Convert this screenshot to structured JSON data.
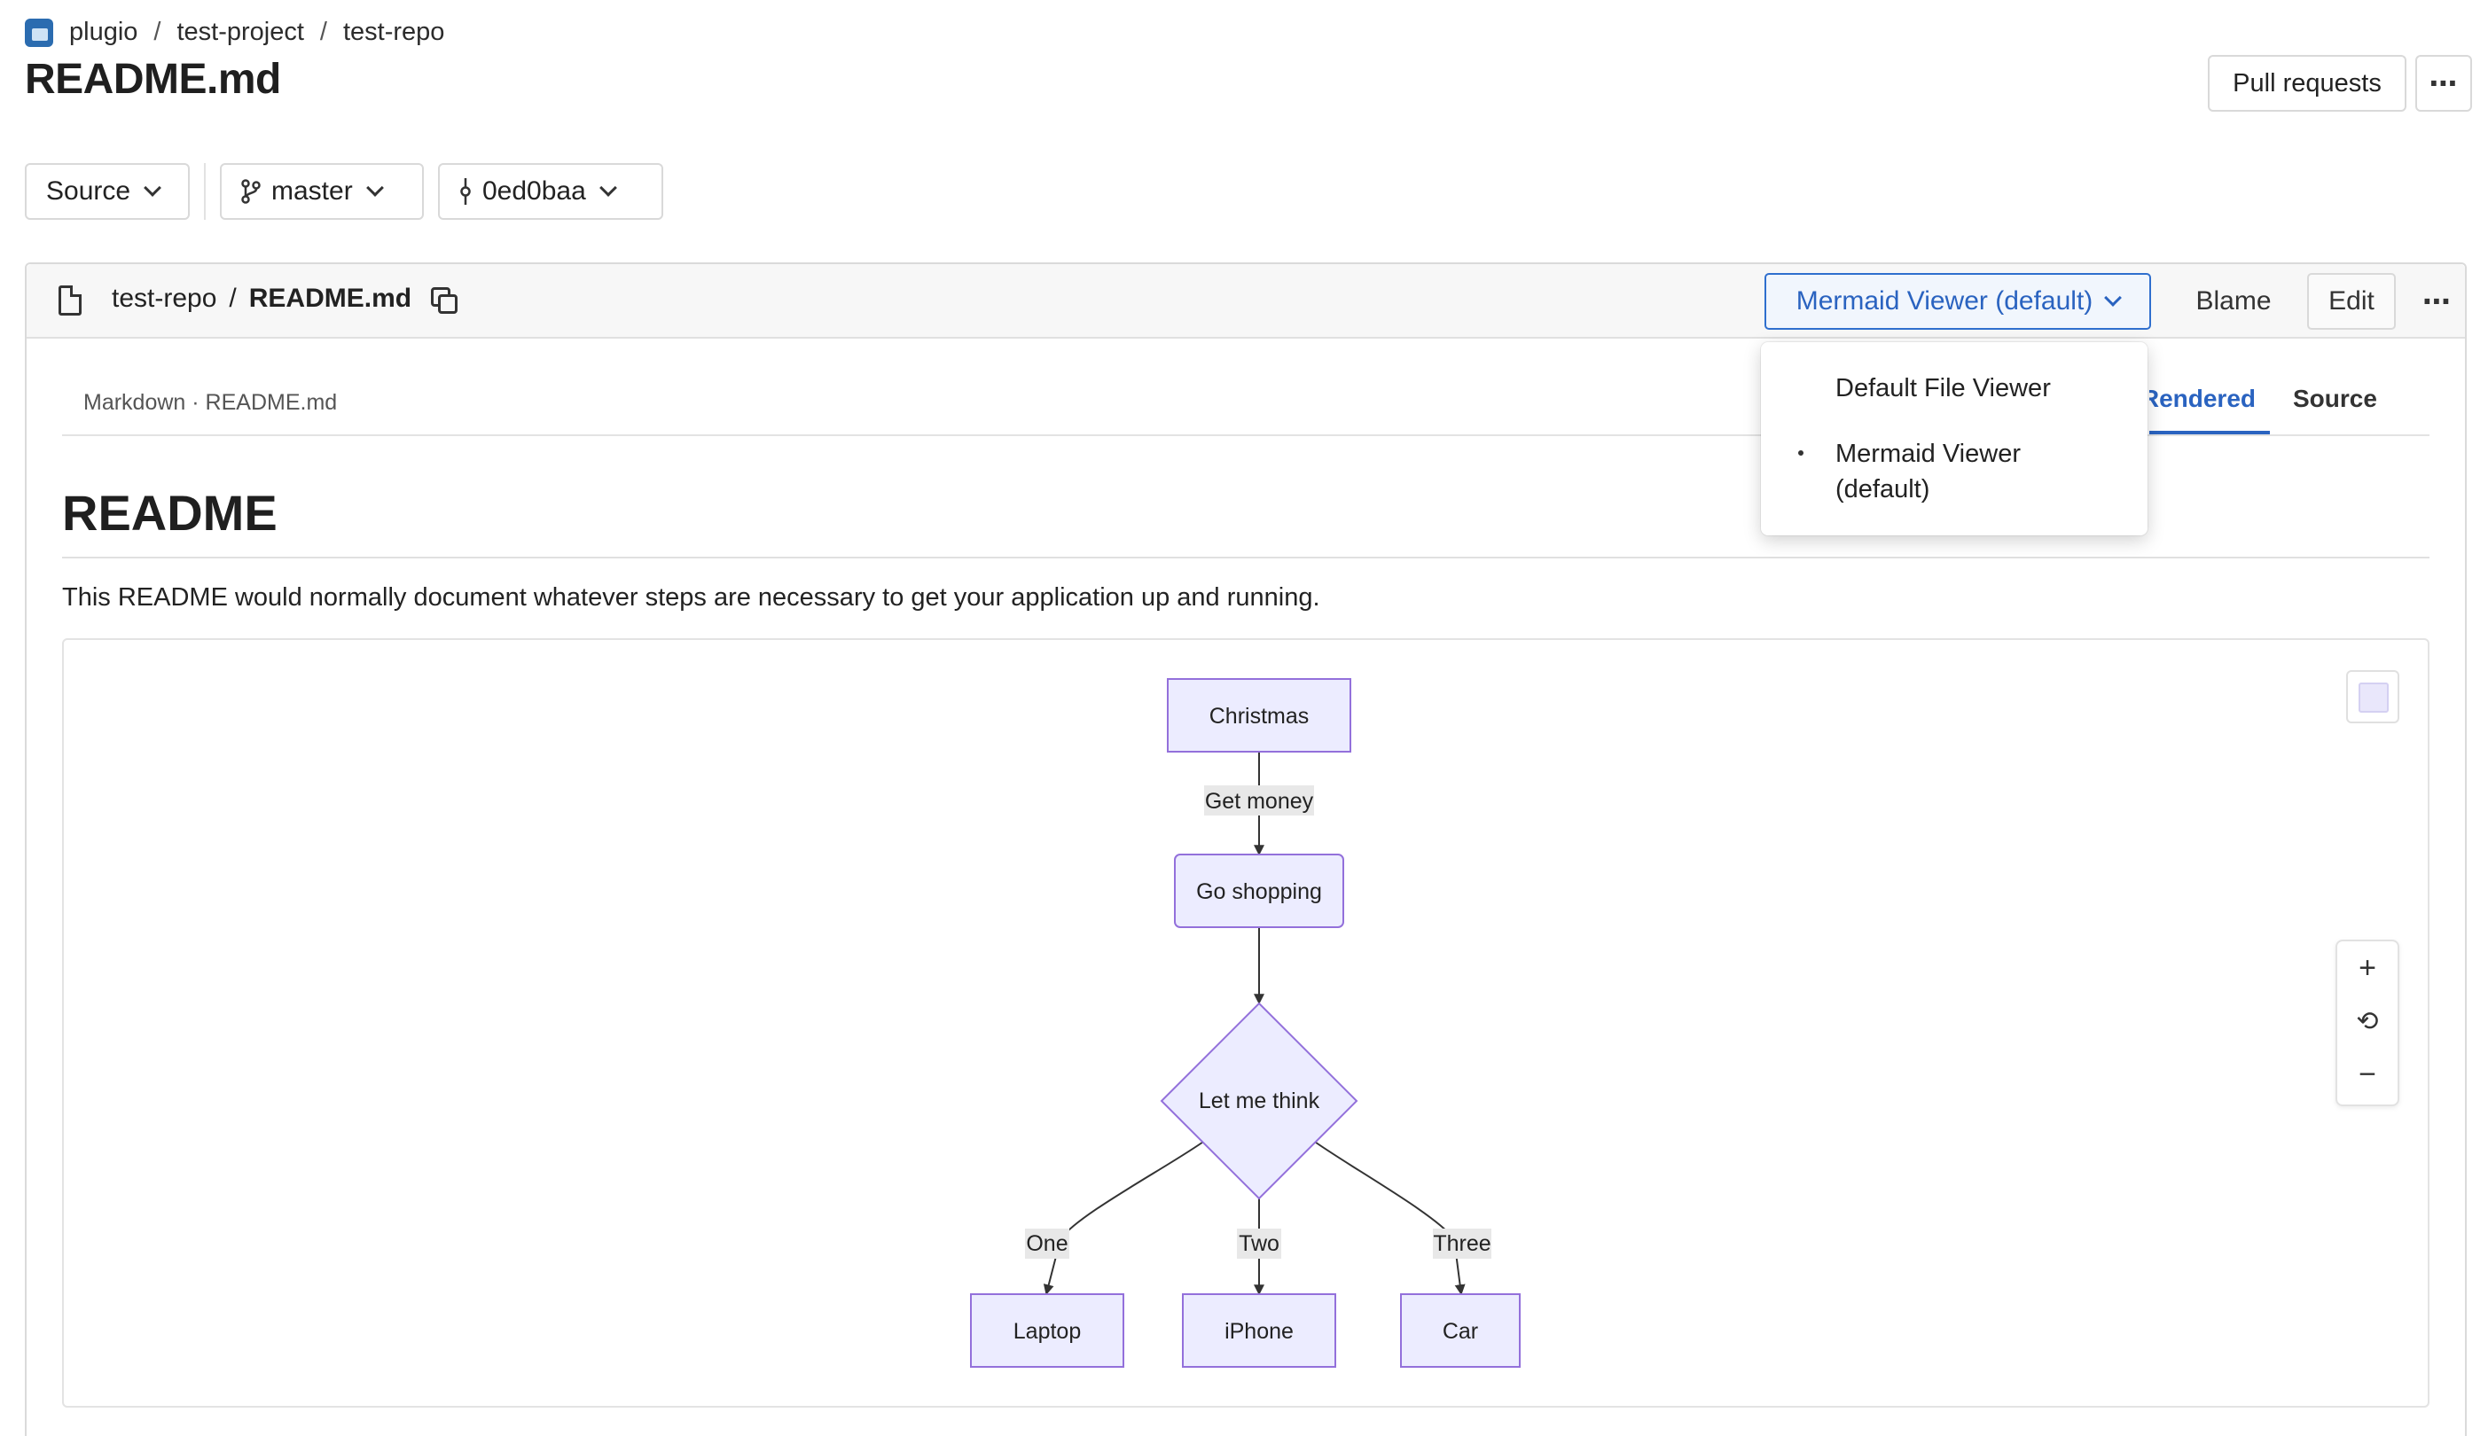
{
  "breadcrumb": {
    "items": [
      "plugio",
      "test-project",
      "test-repo"
    ],
    "separator": "/"
  },
  "page_title": "README.md",
  "header_actions": {
    "pull_requests": "Pull requests",
    "more": "⋯"
  },
  "selectors": {
    "source": "Source",
    "branch": "master",
    "commit": "0ed0baa"
  },
  "file_header": {
    "repo": "test-repo",
    "separator": "/",
    "file": "README.md",
    "viewer_button": "Mermaid Viewer (default)",
    "blame": "Blame",
    "edit": "Edit",
    "more": "⋯"
  },
  "viewer_menu": {
    "items": [
      "Default File Viewer",
      "Mermaid Viewer (default)"
    ],
    "selected": "Mermaid Viewer (default)"
  },
  "content_meta": "Markdown · README.md",
  "content_tabs": {
    "rendered": "Rendered",
    "source": "Source",
    "active": "Rendered"
  },
  "readme": {
    "heading": "README",
    "paragraph": "This README would normally document whatever steps are necessary to get your application up and running."
  },
  "diagram": {
    "nodes": {
      "christmas": "Christmas",
      "go_shopping": "Go shopping",
      "let_me_think": "Let me think",
      "laptop": "Laptop",
      "iphone": "iPhone",
      "car": "Car"
    },
    "edge_labels": {
      "get_money": "Get money",
      "one": "One",
      "two": "Two",
      "three": "Three"
    },
    "colors": {
      "node_fill": "#ececff",
      "node_stroke": "#9370db",
      "edge": "#333333"
    }
  },
  "zoom_controls": {
    "zoom_in": "+",
    "reset": "⟲",
    "zoom_out": "−"
  }
}
